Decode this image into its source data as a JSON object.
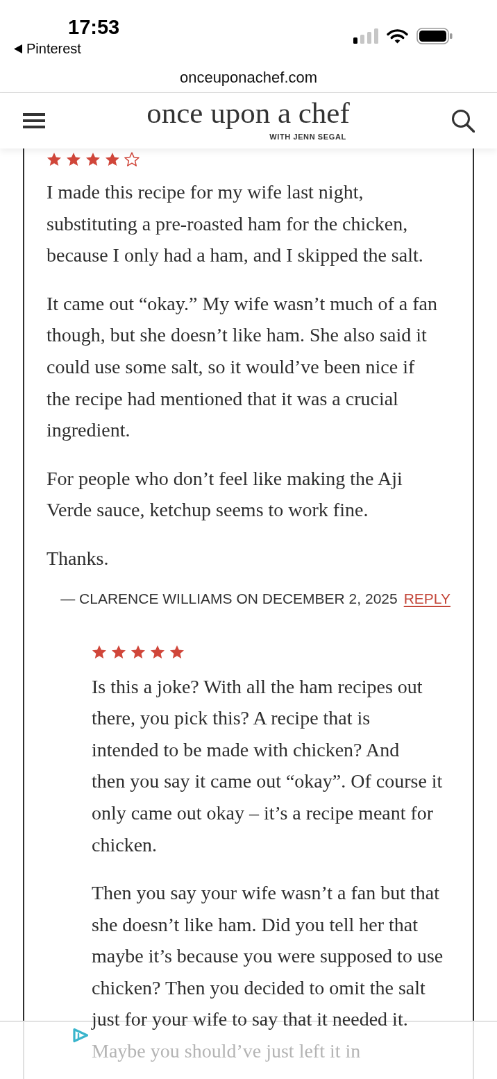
{
  "status_bar": {
    "time": "17:53",
    "back_label": "Pinterest"
  },
  "address_bar": {
    "url": "onceuponachef.com"
  },
  "site_header": {
    "logo": "once upon a chef",
    "tagline": "WITH JENN SEGAL"
  },
  "comments": [
    {
      "stars": 4,
      "paragraphs": [
        {
          "lines": [
            {
              "text": "I made this recipe for my wife last night,",
              "faded": false
            },
            {
              "text": "substituting a pre-roasted ham for the chicken,",
              "faded": false
            },
            {
              "text": "because I only had a ham, and I skipped the salt.",
              "faded": false
            }
          ]
        },
        {
          "lines": [
            {
              "text": "It came out “okay.” My wife wasn’t much of a fan",
              "faded": false
            },
            {
              "text": "though, but she doesn’t like ham. She also said it",
              "faded": false
            },
            {
              "text": "could use some salt, so it would’ve been nice if",
              "faded": false
            },
            {
              "text": "the recipe had mentioned that it was a crucial",
              "faded": false
            },
            {
              "text": "ingredient.",
              "faded": false
            }
          ]
        },
        {
          "lines": [
            {
              "text": "For people who don’t feel like making the Aji",
              "faded": false
            },
            {
              "text": "Verde sauce, ketchup seems to work fine.",
              "faded": false
            }
          ]
        },
        {
          "lines": [
            {
              "text": "Thanks.",
              "faded": false
            }
          ]
        }
      ],
      "attribution": "— CLARENCE WILLIAMS ON DECEMBER 2, 2025",
      "reply_link": "REPLY",
      "children": [
        {
          "stars": 5,
          "paragraphs": [
            {
              "lines": [
                {
                  "text": "Is this a joke? With all the ham recipes out",
                  "faded": false
                },
                {
                  "text": "there, you pick this? A recipe that is",
                  "faded": false
                },
                {
                  "text": "intended to be made with chicken? And",
                  "faded": false
                },
                {
                  "text": "then you say it came out “okay”. Of course it",
                  "faded": false
                },
                {
                  "text": "only came out okay – it’s a recipe meant for",
                  "faded": false
                },
                {
                  "text": "chicken.",
                  "faded": false
                }
              ]
            },
            {
              "lines": [
                {
                  "text": "Then you say your wife wasn’t a fan but that",
                  "faded": false
                },
                {
                  "text": "she doesn’t like ham. Did you tell her that",
                  "faded": false
                },
                {
                  "text": "maybe it’s because you were supposed to use",
                  "faded": false
                },
                {
                  "text": "chicken? Then you decided to omit the salt",
                  "faded": false
                },
                {
                  "text": "just for your wife to say that it needed it.",
                  "faded": false
                },
                {
                  "text": "Maybe you should’ve just left it in",
                  "faded": true
                }
              ]
            }
          ]
        }
      ]
    }
  ]
}
